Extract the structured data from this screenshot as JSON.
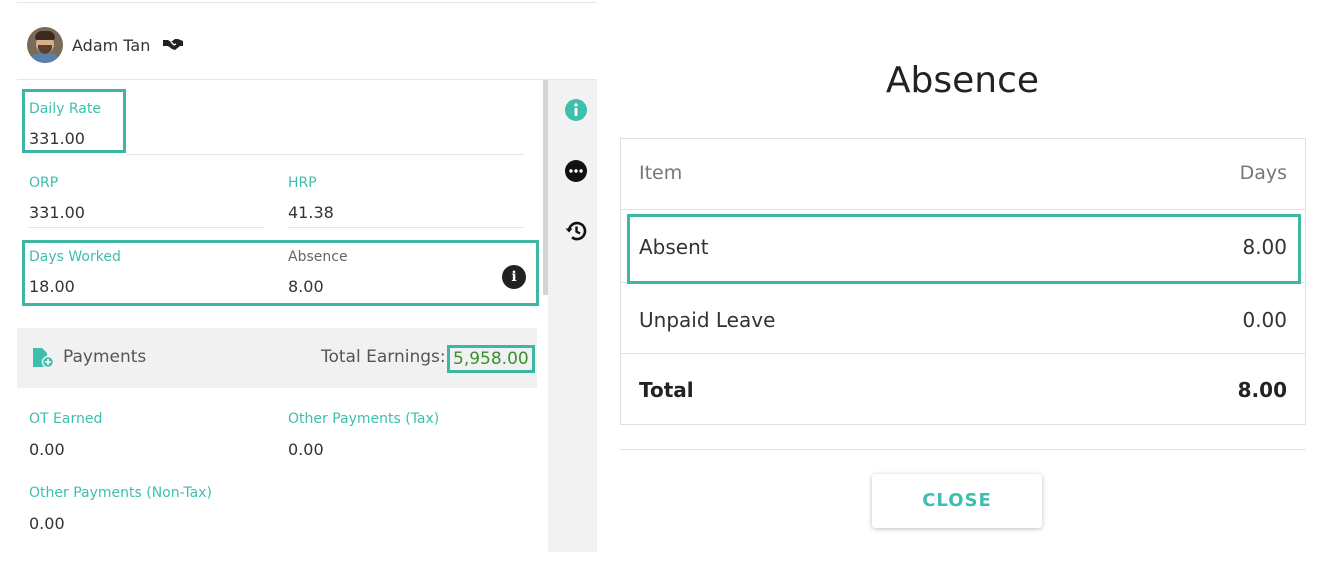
{
  "employee": {
    "name": "Adam Tan",
    "badge_icon": "handshake-icon"
  },
  "fields": {
    "daily_rate": {
      "label": "Daily Rate",
      "value": "331.00"
    },
    "orp": {
      "label": "ORP",
      "value": "331.00"
    },
    "hrp": {
      "label": "HRP",
      "value": "41.38"
    },
    "days_worked": {
      "label": "Days Worked",
      "value": "18.00"
    },
    "absence": {
      "label": "Absence",
      "value": "8.00"
    }
  },
  "payments": {
    "title": "Payments",
    "total_earnings_label": "Total Earnings:",
    "total_earnings_value": "5,958.00",
    "ot_earned": {
      "label": "OT Earned",
      "value": "0.00"
    },
    "other_payments_tax": {
      "label": "Other Payments (Tax)",
      "value": "0.00"
    },
    "other_payments_nontax": {
      "label": "Other Payments (Non-Tax)",
      "value": "0.00"
    }
  },
  "rail": {
    "icons": [
      "info-icon",
      "more-icon",
      "history-icon"
    ]
  },
  "dialog": {
    "title": "Absence",
    "columns": [
      "Item",
      "Days"
    ],
    "rows": [
      {
        "item": "Absent",
        "days": "8.00"
      },
      {
        "item": "Unpaid Leave",
        "days": "0.00"
      }
    ],
    "total": {
      "item": "Total",
      "days": "8.00"
    },
    "close_label": "CLOSE"
  },
  "colors": {
    "accent": "#3ebfae",
    "highlight": "#3fb5a3",
    "earnings_green": "#3a8f2e"
  }
}
